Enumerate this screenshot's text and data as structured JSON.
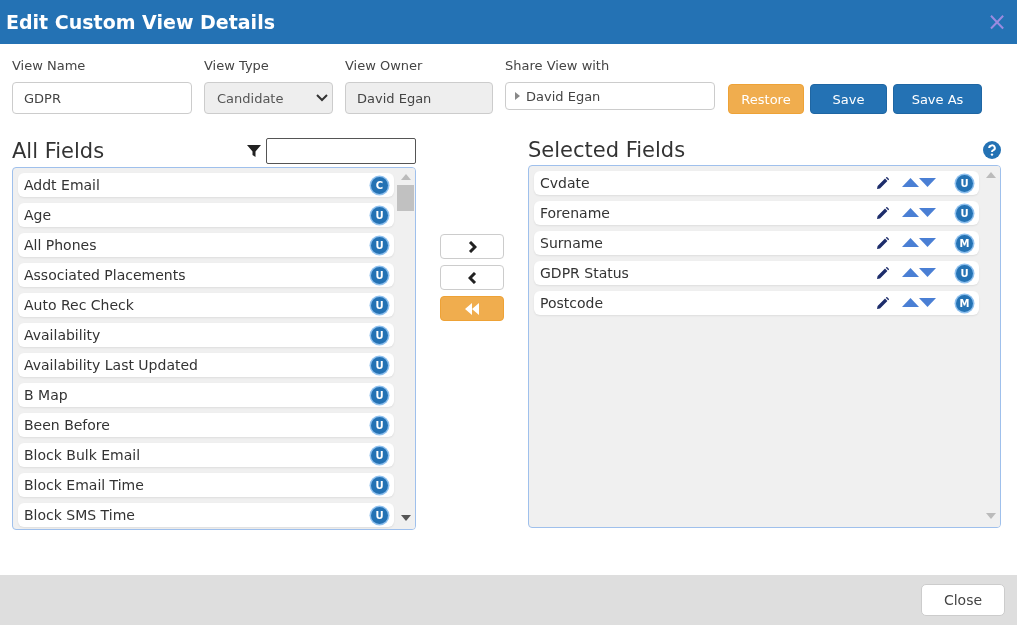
{
  "window": {
    "title": "Edit Custom View Details",
    "close": "×"
  },
  "form": {
    "view_name": {
      "label": "View Name",
      "value": "GDPR"
    },
    "view_type": {
      "label": "View Type",
      "value": "Candidate"
    },
    "view_owner": {
      "label": "View Owner",
      "value": "David Egan"
    },
    "share_view_with": {
      "label": "Share View with",
      "value": "David Egan"
    },
    "buttons": [
      {
        "label": "Restore",
        "kind": "warning"
      },
      {
        "label": "Save",
        "kind": "primary"
      },
      {
        "label": "Save As",
        "kind": "primary"
      }
    ]
  },
  "all_fields": {
    "title": "All Fields",
    "items": [
      {
        "label": "Addt Email",
        "badge": "C"
      },
      {
        "label": "Age",
        "badge": "U"
      },
      {
        "label": "All Phones",
        "badge": "U"
      },
      {
        "label": "Associated Placements",
        "badge": "U"
      },
      {
        "label": "Auto Rec Check",
        "badge": "U"
      },
      {
        "label": "Availability",
        "badge": "U"
      },
      {
        "label": "Availability Last Updated",
        "badge": "U"
      },
      {
        "label": "B Map",
        "badge": "U"
      },
      {
        "label": "Been Before",
        "badge": "U"
      },
      {
        "label": "Block Bulk Email",
        "badge": "U"
      },
      {
        "label": "Block Email Time",
        "badge": "U"
      },
      {
        "label": "Block SMS Time",
        "badge": "U"
      }
    ]
  },
  "selected_fields": {
    "title": "Selected Fields",
    "items": [
      {
        "label": "Cvdate",
        "badge": "U"
      },
      {
        "label": "Forename",
        "badge": "U"
      },
      {
        "label": "Surname",
        "badge": "M"
      },
      {
        "label": "GDPR Status",
        "badge": "U"
      },
      {
        "label": "Postcode",
        "badge": "M"
      }
    ]
  },
  "footer": {
    "close": "Close"
  }
}
